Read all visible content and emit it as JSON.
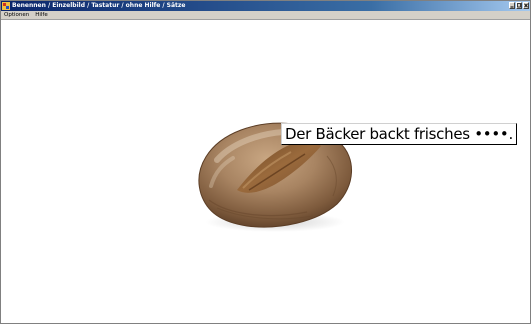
{
  "window": {
    "title": "Benennen / Einzelbild / Tastatur / ohne Hilfe / Sätze"
  },
  "menu": {
    "items": [
      {
        "label": "Optionen"
      },
      {
        "label": "Hilfe"
      }
    ]
  },
  "content": {
    "image": "bread-loaf",
    "sentence": "Der Bäcker backt frisches ••••."
  },
  "colors": {
    "titlebar_start": "#0a246a",
    "titlebar_end": "#a6caf0",
    "menubar": "#d4d0c8",
    "background": "#ffffff"
  }
}
